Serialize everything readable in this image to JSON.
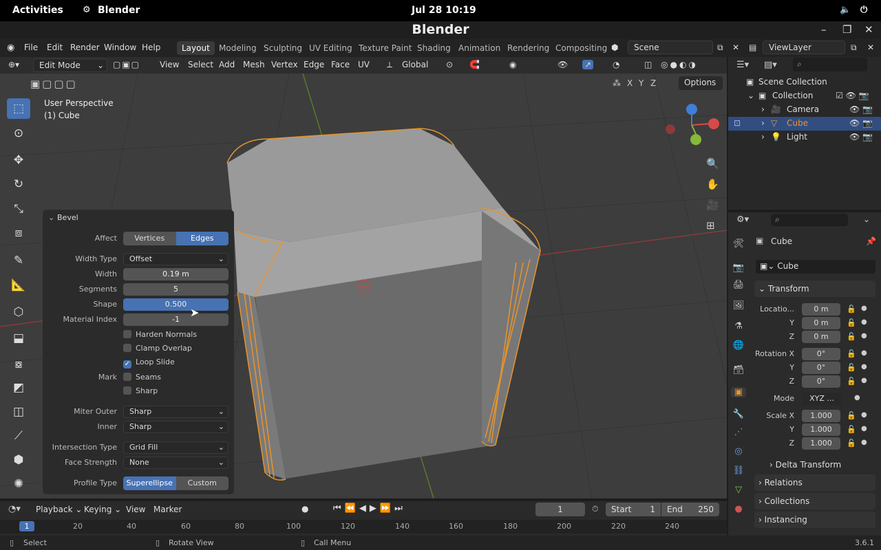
{
  "gnome": {
    "activities": "Activities",
    "app": "Blender",
    "clock": "Jul 28  10:19"
  },
  "window": {
    "title": "Blender",
    "min": "–",
    "max": "❐",
    "close": "✕"
  },
  "menu": {
    "items": [
      "File",
      "Edit",
      "Render",
      "Window",
      "Help"
    ],
    "workspaces": [
      "Layout",
      "Modeling",
      "Sculpting",
      "UV Editing",
      "Texture Paint",
      "Shading",
      "Animation",
      "Rendering",
      "Compositing"
    ],
    "scene": "Scene",
    "viewlayer": "ViewLayer"
  },
  "header": {
    "mode": "Edit Mode",
    "items": [
      "View",
      "Select",
      "Add",
      "Mesh",
      "Vertex",
      "Edge",
      "Face",
      "UV"
    ],
    "orientation": "Global",
    "axes": [
      "X",
      "Y",
      "Z"
    ],
    "options": "Options"
  },
  "viewport": {
    "perspective": "User Perspective",
    "object": "(1) Cube"
  },
  "bevel": {
    "title": "Bevel",
    "affect_label": "Affect",
    "affect": [
      "Vertices",
      "Edges"
    ],
    "affect_selected": "Edges",
    "width_type_label": "Width Type",
    "width_type": "Offset",
    "width_label": "Width",
    "width": "0.19 m",
    "segments_label": "Segments",
    "segments": "5",
    "shape_label": "Shape",
    "shape": "0.500",
    "material_label": "Material Index",
    "material": "-1",
    "harden": "Harden Normals",
    "clamp": "Clamp Overlap",
    "loop": "Loop Slide",
    "mark_label": "Mark",
    "seams": "Seams",
    "sharp": "Sharp",
    "miter_outer_label": "Miter Outer",
    "miter_outer": "Sharp",
    "inner_label": "Inner",
    "inner": "Sharp",
    "intersection_label": "Intersection Type",
    "intersection": "Grid Fill",
    "face_strength_label": "Face Strength",
    "face_strength": "None",
    "profile_label": "Profile Type",
    "profile": [
      "Superellipse",
      "Custom"
    ],
    "profile_selected": "Superellipse"
  },
  "outliner": {
    "scene_collection": "Scene Collection",
    "collection": "Collection",
    "items": [
      "Camera",
      "Cube",
      "Light"
    ],
    "selected": "Cube"
  },
  "properties": {
    "object_name": "Cube",
    "data_name": "Cube",
    "transform": "Transform",
    "location_label": "Locatio...",
    "loc": [
      "0 m",
      "0 m",
      "0 m"
    ],
    "rotation_label": "Rotation X",
    "rot": [
      "0°",
      "0°",
      "0°"
    ],
    "mode_label": "Mode",
    "mode": "XYZ ...",
    "scale_label": "Scale X",
    "scale": [
      "1.000",
      "1.000",
      "1.000"
    ],
    "y": "Y",
    "z": "Z",
    "delta": "Delta Transform",
    "relations": "Relations",
    "collections": "Collections",
    "instancing": "Instancing"
  },
  "timeline": {
    "items": [
      "Playback",
      "Keying",
      "View",
      "Marker"
    ],
    "frame": "1",
    "start_label": "Start",
    "start": "1",
    "end_label": "End",
    "end": "250",
    "ruler": [
      "1",
      "20",
      "40",
      "60",
      "80",
      "100",
      "120",
      "140",
      "160",
      "180",
      "200",
      "220",
      "240"
    ]
  },
  "status": {
    "select": "Select",
    "rotate": "Rotate View",
    "menu": "Call Menu",
    "version": "3.6.1"
  }
}
